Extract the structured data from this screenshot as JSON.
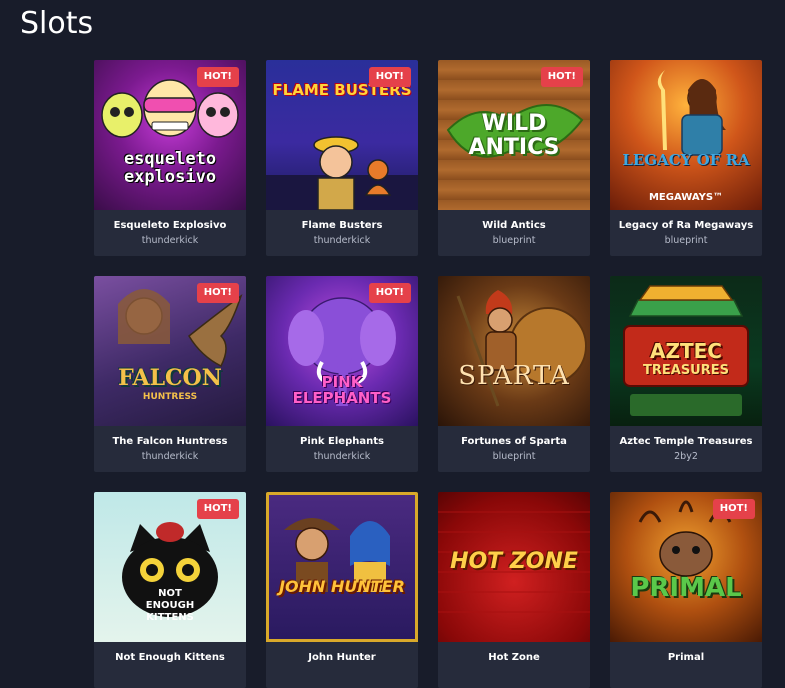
{
  "page": {
    "title": "Slots"
  },
  "hot_label": "HOT!",
  "games": [
    {
      "name": "Esqueleto Explosivo",
      "provider": "thunderkick",
      "hot": true,
      "logo": "esqueleto explosivo",
      "icon": "skull-icon"
    },
    {
      "name": "Flame Busters",
      "provider": "thunderkick",
      "hot": true,
      "logo": "FLAME BUSTERS",
      "icon": "firefighter-icon"
    },
    {
      "name": "Wild Antics",
      "provider": "blueprint",
      "hot": true,
      "logo": "WILD ANTICS",
      "icon": "ant-icon"
    },
    {
      "name": "Legacy of Ra Megaways",
      "provider": "blueprint",
      "hot": false,
      "logo": "LEGACY OF RA",
      "logo_sub": "MEGAWAYS™",
      "icon": "explorer-icon"
    },
    {
      "name": "The Falcon Huntress",
      "provider": "thunderkick",
      "hot": true,
      "logo": "FALCON",
      "logo_sub": "HUNTRESS",
      "icon": "falcon-icon"
    },
    {
      "name": "Pink Elephants",
      "provider": "thunderkick",
      "hot": true,
      "logo": "PINK ELEPHANTS",
      "icon": "elephant-icon"
    },
    {
      "name": "Fortunes of Sparta",
      "provider": "blueprint",
      "hot": false,
      "logo": "SPARTA",
      "icon": "spartan-icon"
    },
    {
      "name": "Aztec Temple Treasures",
      "provider": "2by2",
      "hot": false,
      "logo": "AZTEC",
      "logo_sub": "TREASURES",
      "icon": "temple-icon"
    },
    {
      "name": "Not Enough Kittens",
      "provider": "",
      "hot": true,
      "logo": "NOT ENOUGH KITTENS",
      "icon": "cat-icon"
    },
    {
      "name": "John Hunter",
      "provider": "",
      "hot": false,
      "logo": "JOHN HUNTER",
      "icon": "adventurer-icon"
    },
    {
      "name": "Hot Zone",
      "provider": "",
      "hot": false,
      "logo": "HOT ZONE",
      "icon": "flame-icon"
    },
    {
      "name": "Primal",
      "provider": "",
      "hot": true,
      "logo": "PRIMAL",
      "icon": "warrior-icon"
    }
  ],
  "colors": {
    "background": "#181c2a",
    "card": "#262b3b",
    "hot_badge": "#e5414a",
    "provider_text": "#b7bccb"
  }
}
